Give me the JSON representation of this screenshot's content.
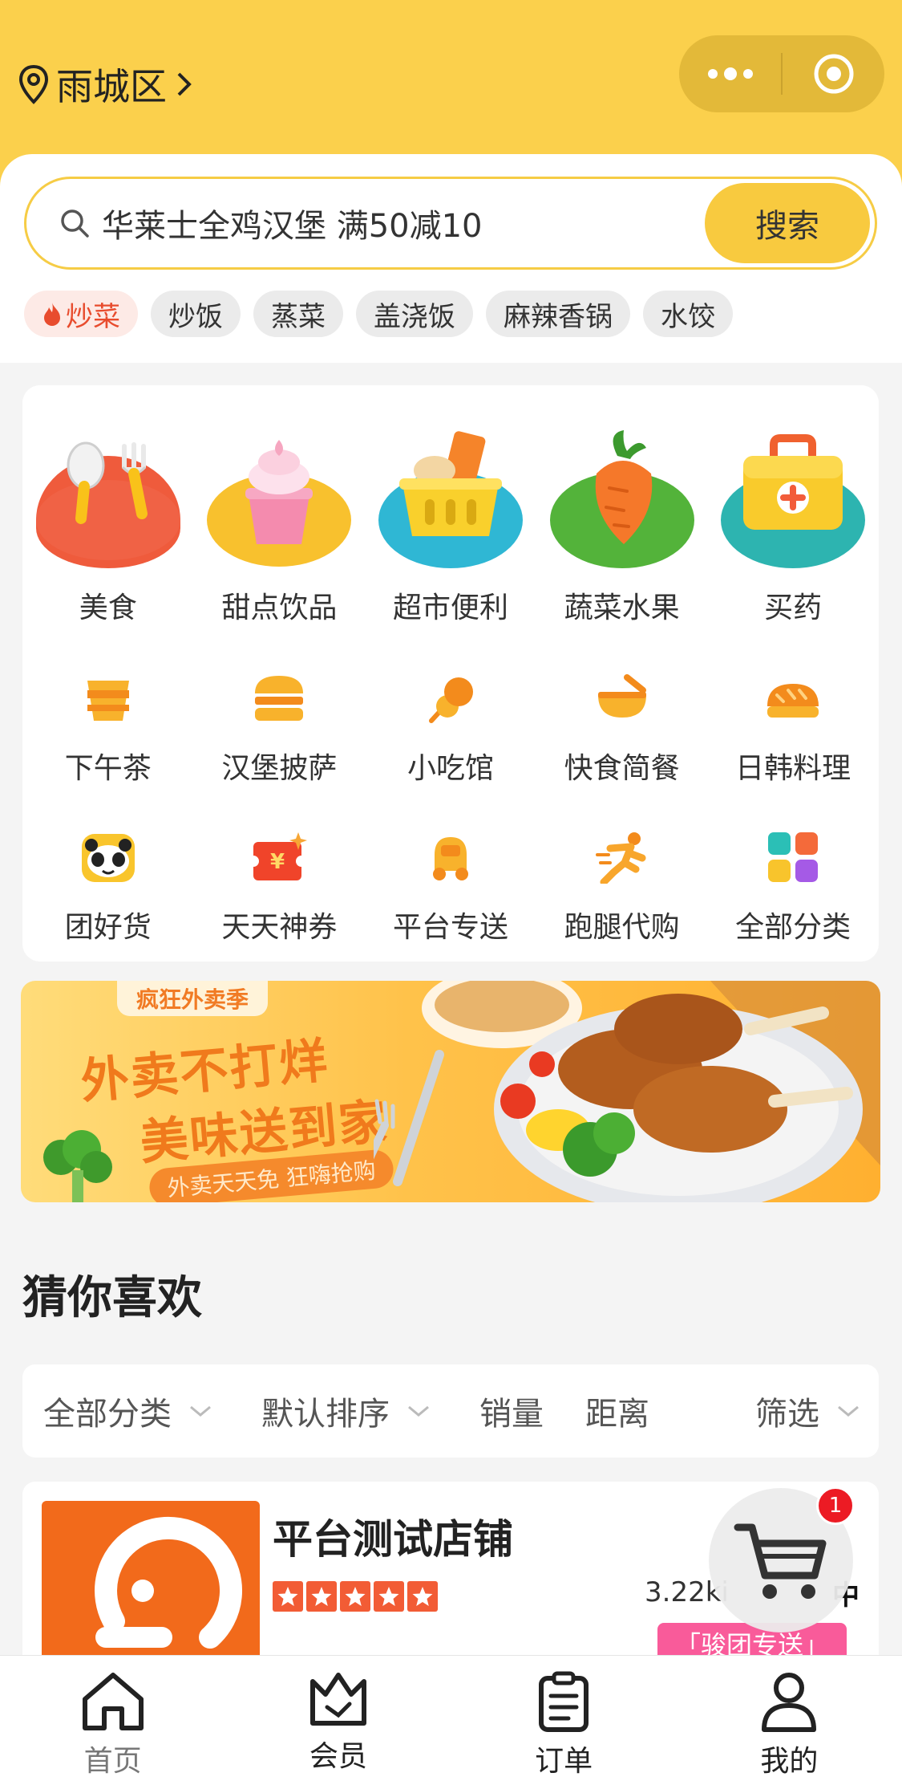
{
  "header": {
    "location": "雨城区"
  },
  "search": {
    "placeholder": "华莱士全鸡汉堡 满50减10",
    "button": "搜索"
  },
  "hot_tags": [
    "炒菜",
    "炒饭",
    "蒸菜",
    "盖浇饭",
    "麻辣香锅",
    "水饺"
  ],
  "categories_main": [
    {
      "label": "美食",
      "icon": "fork-spoon-icon"
    },
    {
      "label": "甜点饮品",
      "icon": "ice-cream-icon"
    },
    {
      "label": "超市便利",
      "icon": "basket-icon"
    },
    {
      "label": "蔬菜水果",
      "icon": "carrot-icon"
    },
    {
      "label": "买药",
      "icon": "medicine-box-icon"
    }
  ],
  "categories_row2": [
    {
      "label": "下午茶",
      "icon": "cup-icon"
    },
    {
      "label": "汉堡披萨",
      "icon": "burger-icon"
    },
    {
      "label": "小吃馆",
      "icon": "skewer-icon"
    },
    {
      "label": "快食简餐",
      "icon": "bowl-icon"
    },
    {
      "label": "日韩料理",
      "icon": "sushi-icon"
    }
  ],
  "categories_row3": [
    {
      "label": "团好货",
      "icon": "panda-icon"
    },
    {
      "label": "天天神券",
      "icon": "coupon-icon"
    },
    {
      "label": "平台专送",
      "icon": "scooter-icon"
    },
    {
      "label": "跑腿代购",
      "icon": "runner-icon"
    },
    {
      "label": "全部分类",
      "icon": "grid-icon"
    }
  ],
  "banner": {
    "tag": "疯狂外卖季",
    "line1": "外卖不打烊",
    "line2": "美味送到家",
    "sub": "外卖天天免 狂嗨抢购"
  },
  "section": {
    "title": "猜你喜欢"
  },
  "filters": {
    "all_categories": "全部分类",
    "default_sort": "默认排序",
    "sales": "销量",
    "distance": "距离",
    "filter": "筛选"
  },
  "shop": {
    "name": "平台测试店铺",
    "rating": 5,
    "distance": "3.22ki",
    "distance_tail": "中",
    "badge": "「骏团专送」"
  },
  "cart": {
    "count": "1"
  },
  "tabbar": [
    {
      "label": "首页",
      "icon": "home-icon"
    },
    {
      "label": "会员",
      "icon": "crown-icon"
    },
    {
      "label": "订单",
      "icon": "order-icon"
    },
    {
      "label": "我的",
      "icon": "user-icon"
    }
  ],
  "colors": {
    "brand": "#fbd04c",
    "search_button": "#f8ca3f",
    "hot_tag": "#e84c2e",
    "orange": "#f07a1c",
    "badge_pink": "#f95b9a"
  }
}
